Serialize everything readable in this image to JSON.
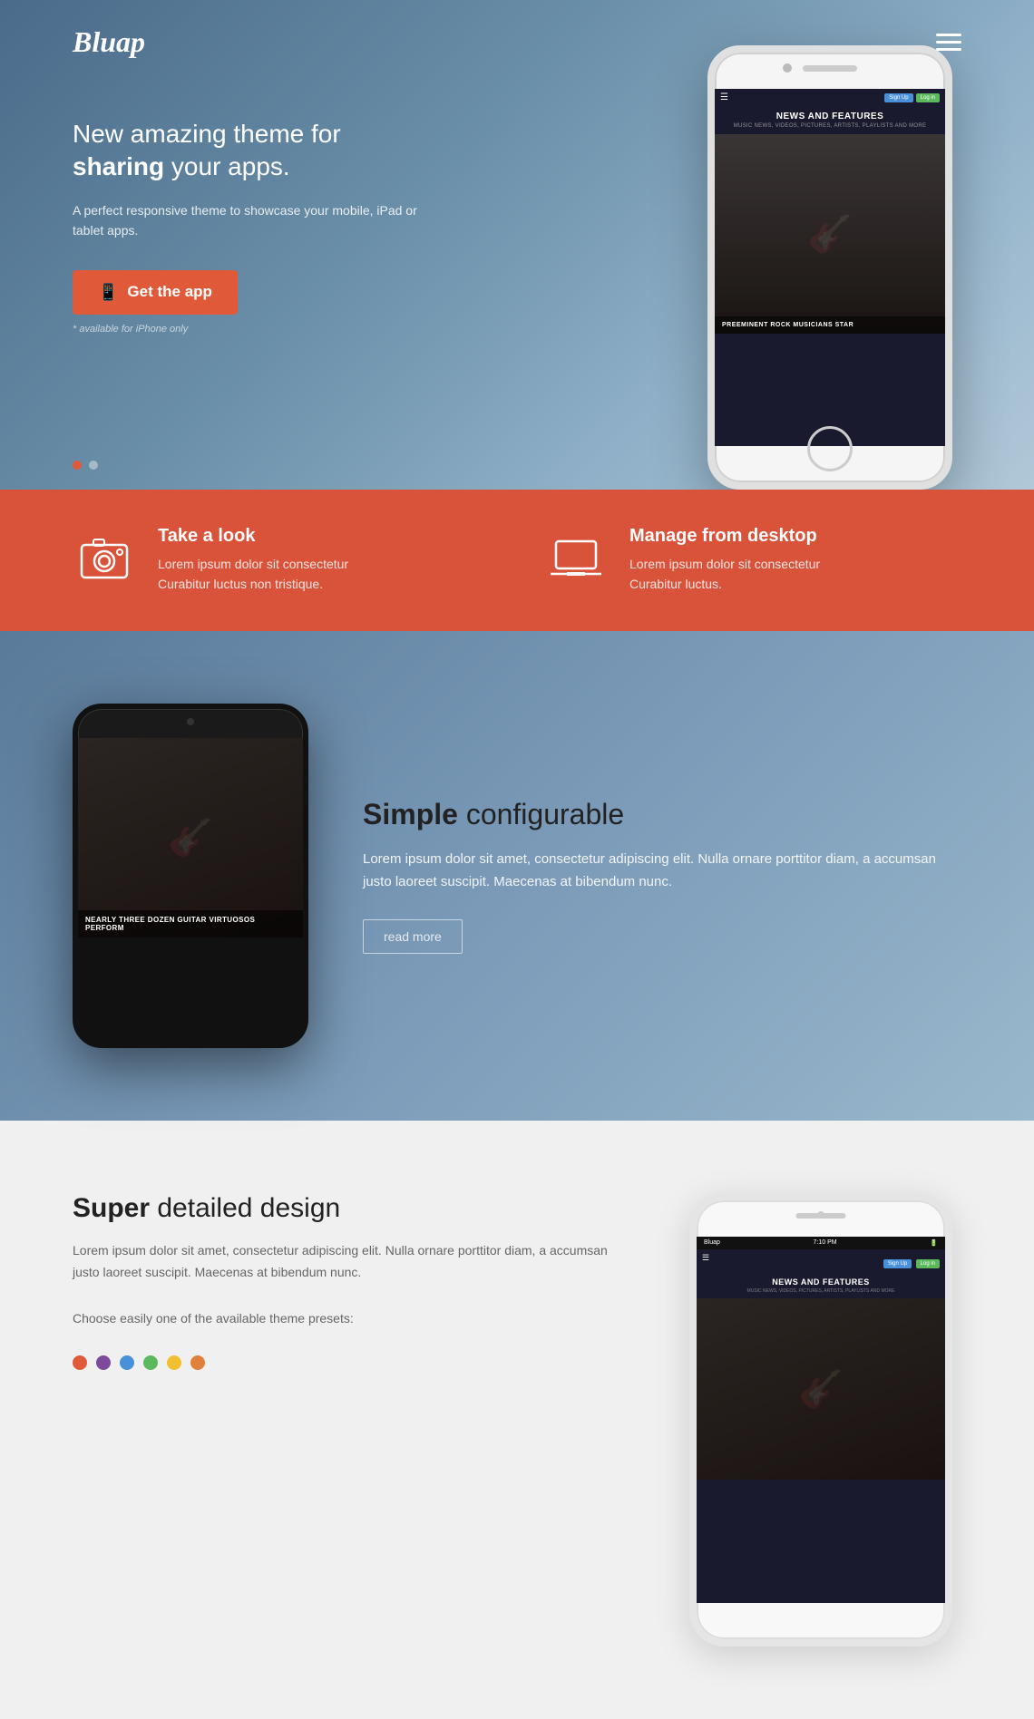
{
  "brand": {
    "logo": "Bluap"
  },
  "nav": {
    "hamburger_label": "menu"
  },
  "hero": {
    "tagline_pre": "New amazing theme for ",
    "tagline_bold": "sharing",
    "tagline_post": " your apps.",
    "subtitle": "A perfect responsive theme to showcase your mobile, iPad or tablet apps.",
    "cta_label": "Get the app",
    "note": "* available for iPhone only",
    "dots": [
      true,
      false
    ],
    "phone": {
      "news_title": "NEWS AND FEATURES",
      "news_sub": "MUSIC NEWS, VIDEOS, PICTURES, ARTISTS, PLAYLISTS AND MORE",
      "caption": "PREEMINENT ROCK MUSICIANS STAR"
    }
  },
  "features": [
    {
      "icon": "camera-icon",
      "title": "Take a look",
      "text1": "Lorem ipsum dolor sit consectetur",
      "text2": "Curabitur luctus non tristique."
    },
    {
      "icon": "laptop-icon",
      "title": "Manage from desktop",
      "text1": "Lorem ipsum dolor sit consectetur",
      "text2": "Curabitur luctus."
    }
  ],
  "section_simple": {
    "heading_bold": "Simple",
    "heading_rest": " configurable",
    "body": "Lorem ipsum dolor sit amet, consectetur adipiscing elit. Nulla ornare porttitor diam, a accumsan justo laoreet suscipit. Maecenas at bibendum nunc.",
    "read_more": "read more",
    "phone": {
      "caption": "NEARLY THREE DOZEN GUITAR VIRTUOSOS PERFORM"
    }
  },
  "section_super": {
    "heading_bold": "Super",
    "heading_rest": " detailed design",
    "body": "Lorem ipsum dolor sit amet, consectetur adipiscing elit. Nulla ornare porttitor diam, a accumsan justo laoreet suscipit. Maecenas at bibendum nunc.",
    "presets_label": "Choose easily one of the available theme presets:",
    "color_dots": [
      "#e05a3a",
      "#7c4b9b",
      "#4a90d9",
      "#5cb85c",
      "#f0c030",
      "#e0803a"
    ],
    "phone": {
      "status_left": "Bluap",
      "status_time": "7:10 PM",
      "news_title": "NEWS AND FEATURES",
      "news_sub": "MUSIC NEWS, VIDEOS, PICTURES, ARTISTS, PLAYLISTS AND MORE"
    }
  }
}
